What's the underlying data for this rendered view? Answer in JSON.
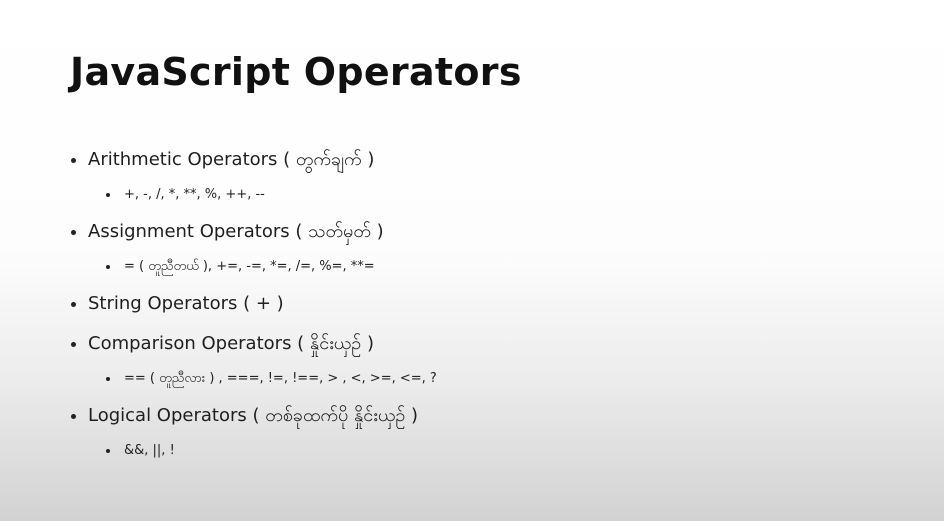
{
  "slide": {
    "title": "JavaScript Operators",
    "items": [
      {
        "label": "Arithmetic Operators ( တွက်ချက် )",
        "sub": "+, -, /, *, **, %, ++, --"
      },
      {
        "label": "Assignment Operators  ( သတ်မှတ် )",
        "sub": "= ( တူညီတယ် ), +=, -=,  *=,  /=,  %=, **="
      },
      {
        "label": "String Operators ( + )"
      },
      {
        "label": "Comparison Operators  ( နှိုင်းယှဉ် )",
        "sub": "== ( တူညီလား ) , ===,  !=,  !==, > , <, >=, <=, ?"
      },
      {
        "label": "Logical Operators  ( တစ်ခုထက်ပို နှိုင်းယှဉ် )",
        "sub": "&&, ||, !"
      }
    ]
  }
}
